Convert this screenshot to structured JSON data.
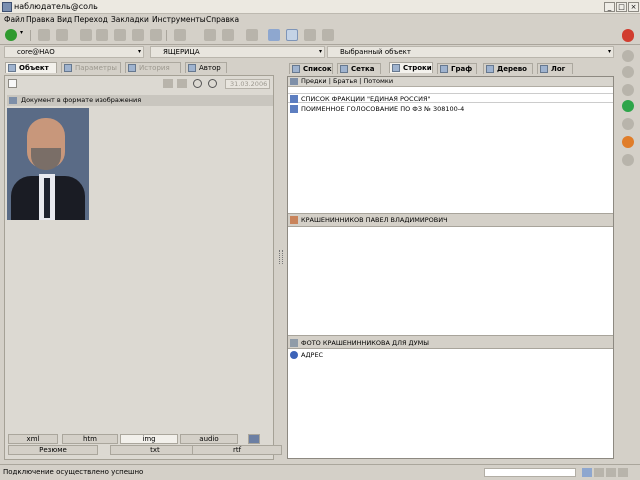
{
  "window": {
    "title": "наблюдатель@соль"
  },
  "menu": [
    "Файл",
    "Правка",
    "Вид",
    "Переход",
    "Закладки",
    "Инструменты",
    "Справка"
  ],
  "combos": {
    "left": "core@НАО",
    "middle": "ЯЩЕРИЦА",
    "right": "Выбранный объект"
  },
  "left_tabs": [
    "Объект",
    "Параметры",
    "История",
    "Автор"
  ],
  "left_date": "31.03.2006",
  "left_doc_label": "Документ в формате изображения",
  "right_tabs": [
    "Список",
    "Сетка",
    "Строки",
    "Граф",
    "Дерево",
    "Лог"
  ],
  "right_header": "Предки | Братья | Потомки",
  "right_items": [
    "СПИСОК ФРАКЦИИ \"ЕДИНАЯ РОССИЯ\"",
    "ПОИМЕННОЕ ГОЛОСОВАНИЕ ПО ФЗ № 308100-4"
  ],
  "person_header": "КРАШЕНИННИКОВ ПАВЕЛ ВЛАДИМИРОВИЧ",
  "photo_header": "ФОТО КРАШЕНИННИКОВА ДЛЯ ДУМЫ",
  "address_label": "АДРЕС",
  "bottom_tabs_row1": [
    "xml",
    "htm",
    "img",
    "audio"
  ],
  "bottom_tabs_row2": [
    "Резюме",
    "txt",
    "rtf"
  ],
  "status": {
    "text": "Подключение осуществлено успешно"
  }
}
